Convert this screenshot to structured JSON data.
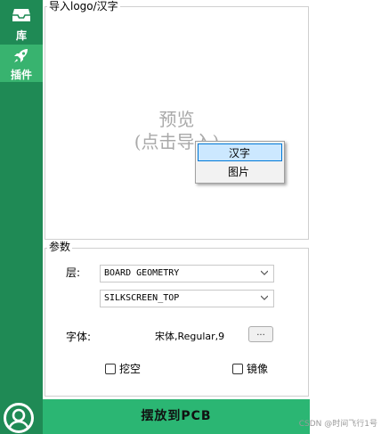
{
  "sidebar": {
    "items": [
      {
        "label": "库",
        "icon": "tray-icon",
        "active": false
      },
      {
        "label": "插件",
        "icon": "rocket-icon",
        "active": true
      }
    ]
  },
  "import_group": {
    "title": "导入logo/汉字",
    "preview_line1": "预览",
    "preview_line2": "(点击导入)"
  },
  "context_menu": {
    "items": [
      {
        "label": "汉字",
        "highlighted": true
      },
      {
        "label": "图片",
        "highlighted": false
      }
    ]
  },
  "params_group": {
    "title": "参数",
    "layer_label": "层:",
    "layer_class": "BOARD GEOMETRY",
    "layer_subclass": "SILKSCREEN_TOP",
    "font_label": "字体:",
    "font_value": "宋体,Regular,9",
    "font_button": "...",
    "carve_label": "挖空",
    "mirror_label": "镜像"
  },
  "place_button": "摆放到PCB",
  "watermark": "CSDN @时间飞行1号",
  "colors": {
    "sidebar": "#1f8a55",
    "sidebar_active": "#38b36f",
    "place_button": "#2bb673",
    "menu_highlight": "#cce8ff"
  }
}
